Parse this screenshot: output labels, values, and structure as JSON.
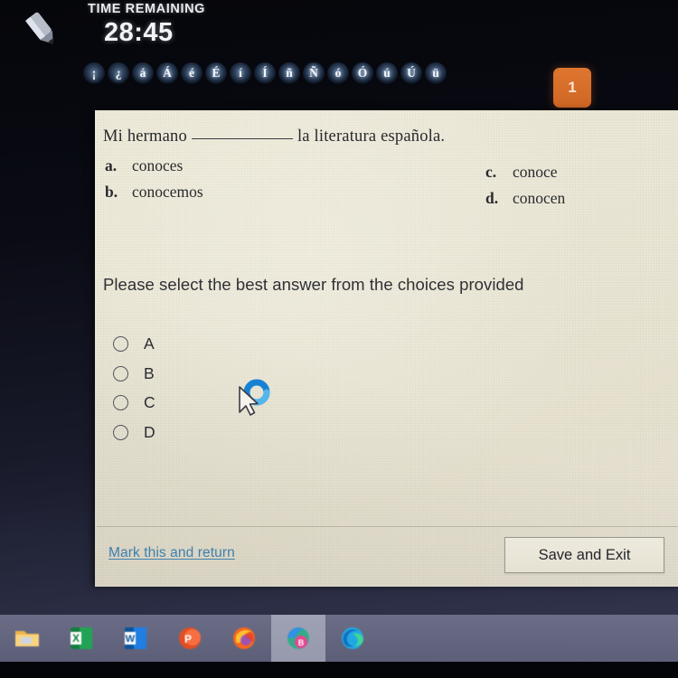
{
  "timer": {
    "label": "TIME REMAINING",
    "value": "28:45"
  },
  "icons": {
    "pencil": "pencil-icon",
    "cursor": "mouse-cursor-busy-icon"
  },
  "accent_keys": [
    "¡",
    "¿",
    "á",
    "Á",
    "é",
    "É",
    "í",
    "Í",
    "ñ",
    "Ñ",
    "ó",
    "Ó",
    "ú",
    "Ú",
    "ü"
  ],
  "question_badge": "1",
  "question": {
    "stem_before": "Mi hermano",
    "stem_after": "la literatura española.",
    "options": [
      {
        "letter": "a.",
        "text": "conoces"
      },
      {
        "letter": "b.",
        "text": "conocemos"
      },
      {
        "letter": "c.",
        "text": "conoce"
      },
      {
        "letter": "d.",
        "text": "conocen"
      }
    ]
  },
  "instruction": "Please select the best answer from the choices provided",
  "answer_choices": [
    {
      "label": "A",
      "selected": false
    },
    {
      "label": "B",
      "selected": false
    },
    {
      "label": "C",
      "selected": false
    },
    {
      "label": "D",
      "selected": false
    }
  ],
  "footer": {
    "mark_link": "Mark this and return",
    "save_exit": "Save and Exit"
  },
  "taskbar": {
    "items": [
      {
        "name": "file-explorer-icon",
        "active": false
      },
      {
        "name": "excel-icon",
        "active": false
      },
      {
        "name": "word-icon",
        "active": false
      },
      {
        "name": "powerpoint-icon",
        "active": false
      },
      {
        "name": "firefox-icon",
        "active": false
      },
      {
        "name": "brave-browser-icon",
        "active": true
      },
      {
        "name": "edge-icon",
        "active": false
      }
    ]
  },
  "colors": {
    "panel_bg": "#ebe7d6",
    "badge_orange": "#d66d28",
    "link_blue": "#3d7fae",
    "taskbar": "#70728c"
  }
}
